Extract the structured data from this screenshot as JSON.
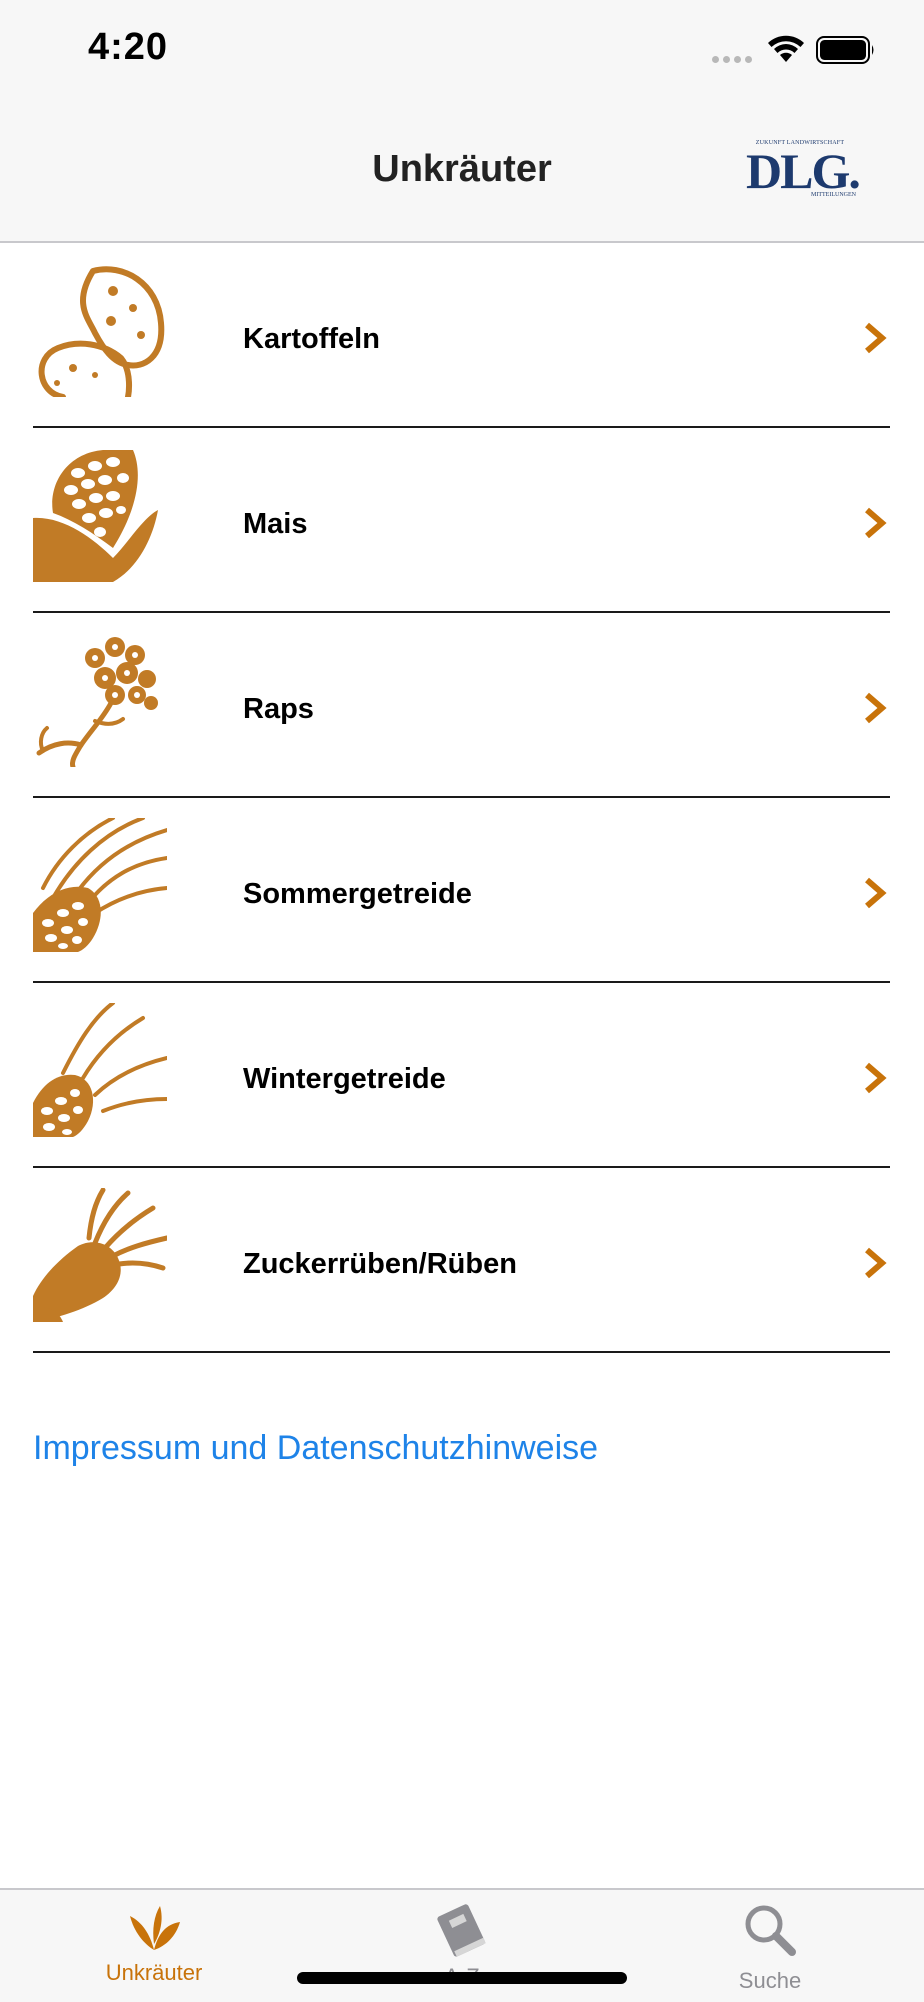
{
  "status_bar": {
    "time": "4:20"
  },
  "nav": {
    "title": "Unkräuter",
    "logo": {
      "top": "ZUKUNFT LANDWIRTSCHAFT",
      "main": "DLG.",
      "bottom": "MITTEILUNGEN"
    }
  },
  "categories": [
    {
      "label": "Kartoffeln",
      "icon": "potato-icon"
    },
    {
      "label": "Mais",
      "icon": "corn-icon"
    },
    {
      "label": "Raps",
      "icon": "rapeseed-icon"
    },
    {
      "label": "Sommergetreide",
      "icon": "summer-grain-icon"
    },
    {
      "label": "Wintergetreide",
      "icon": "winter-grain-icon"
    },
    {
      "label": "Zuckerrüben/Rüben",
      "icon": "sugar-beet-icon"
    }
  ],
  "footer": {
    "impressum": "Impressum und Datenschutzhinweise"
  },
  "tabs": [
    {
      "label": "Unkräuter",
      "icon": "weeds-icon",
      "active": true
    },
    {
      "label": "A-Z",
      "icon": "book-icon",
      "active": false
    },
    {
      "label": "Suche",
      "icon": "search-icon",
      "active": false
    }
  ],
  "colors": {
    "accent": "#c8730a",
    "icon_brown": "#c17b26",
    "link": "#1e83e8",
    "logo_navy": "#1d3a6e",
    "inactive": "#8e8e93"
  }
}
